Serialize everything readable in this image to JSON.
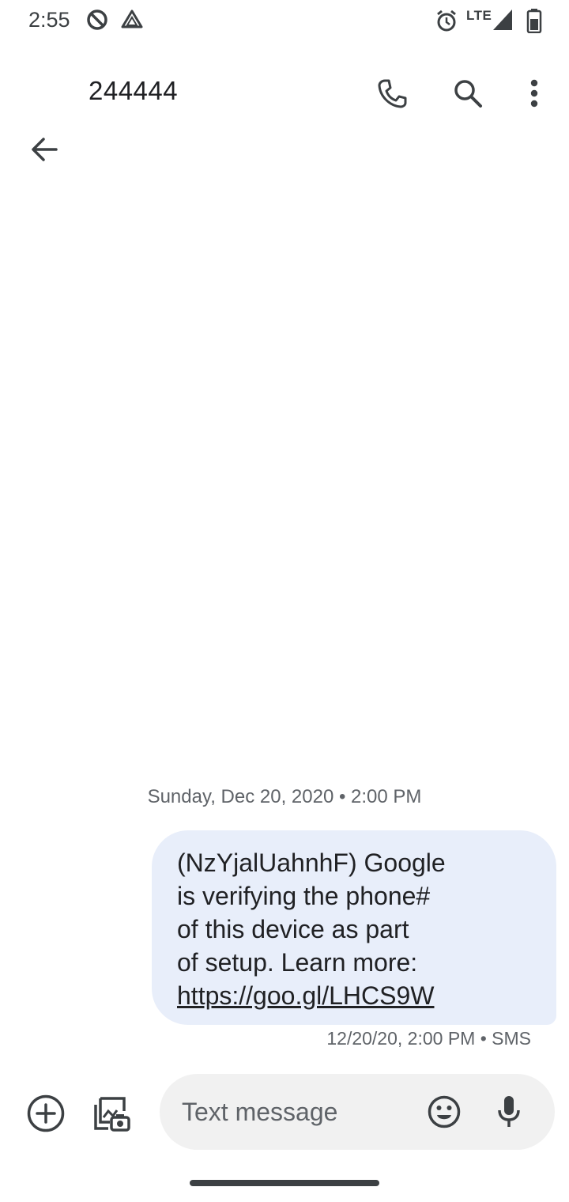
{
  "status_bar": {
    "time": "2:55",
    "network": "LTE",
    "icons": [
      "data-saver-icon",
      "drive-icon",
      "alarm-icon",
      "signal-icon",
      "battery-icon"
    ]
  },
  "conversation": {
    "title": "244444",
    "actions": [
      "back-arrow-icon",
      "phone-icon",
      "search-icon",
      "more-vert-icon"
    ]
  },
  "messages": [
    {
      "date_header": "Sunday, Dec 20, 2020 • 2:00 PM",
      "text_lines": "(NzYjalUahnhF) Google\nis verifying the phone#\nof this device as part\nof setup. Learn more:",
      "link": "https://goo.gl/LHCS9W",
      "meta": "12/20/20, 2:00 PM • SMS"
    }
  ],
  "compose": {
    "placeholder": "Text message",
    "icons": [
      "add-circle-icon",
      "gallery-camera-icon",
      "emoji-icon",
      "mic-icon"
    ]
  },
  "colors": {
    "bubble": "#e8eefa",
    "compose_bg": "#f1f1f1",
    "icon": "#3c4043"
  }
}
